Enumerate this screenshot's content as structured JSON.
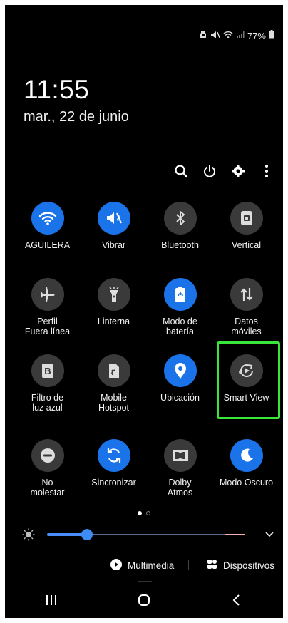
{
  "status_bar": {
    "battery_percent": "77%",
    "icons": [
      "alarm-icon",
      "mute-icon",
      "wifi-icon",
      "signal-icon",
      "battery-icon"
    ]
  },
  "clock": {
    "time": "11:55",
    "date": "mar., 22 de junio"
  },
  "top_actions": [
    "search-icon",
    "power-icon",
    "gear-icon",
    "more-vertical-icon"
  ],
  "tiles": [
    {
      "id": "wifi",
      "label": "AGUILERA",
      "state": "on",
      "icon": "wifi-icon"
    },
    {
      "id": "vibrate",
      "label": "Vibrar",
      "state": "on",
      "icon": "vibrate-icon"
    },
    {
      "id": "bluetooth",
      "label": "Bluetooth",
      "state": "off",
      "icon": "bluetooth-icon"
    },
    {
      "id": "rotation",
      "label": "Vertical",
      "state": "off",
      "icon": "portrait-lock-icon"
    },
    {
      "id": "airplane",
      "label": "Perfil\nFuera línea",
      "state": "off",
      "icon": "airplane-icon"
    },
    {
      "id": "flashlight",
      "label": "Linterna",
      "state": "off",
      "icon": "flashlight-icon"
    },
    {
      "id": "battery-mode",
      "label": "Modo de\nbatería",
      "state": "on",
      "icon": "battery-saver-icon"
    },
    {
      "id": "mobile-data",
      "label": "Datos\nmóviles",
      "state": "off",
      "icon": "data-arrows-icon"
    },
    {
      "id": "blue-light",
      "label": "Filtro de\nluz azul",
      "state": "off",
      "icon": "blue-light-icon"
    },
    {
      "id": "hotspot",
      "label": "Mobile\nHotspot",
      "state": "off",
      "icon": "hotspot-icon"
    },
    {
      "id": "location",
      "label": "Ubicación",
      "state": "on",
      "icon": "location-pin-icon"
    },
    {
      "id": "smart-view",
      "label": "Smart View",
      "state": "off",
      "icon": "smart-view-icon"
    },
    {
      "id": "dnd",
      "label": "No\nmolestar",
      "state": "off",
      "icon": "do-not-disturb-icon"
    },
    {
      "id": "sync",
      "label": "Sincronizar",
      "state": "on",
      "icon": "sync-icon"
    },
    {
      "id": "dolby",
      "label": "Dolby\nAtmos",
      "state": "off",
      "icon": "dolby-icon"
    },
    {
      "id": "dark-mode",
      "label": "Modo Oscuro",
      "state": "on",
      "icon": "moon-icon"
    }
  ],
  "pager": {
    "pages": 2,
    "current": 1
  },
  "brightness": {
    "level": 0.2
  },
  "bottom_buttons": {
    "media_label": "Multimedia",
    "devices_label": "Dispositivos"
  },
  "nav": [
    "recents-icon",
    "home-icon",
    "back-icon"
  ],
  "colors": {
    "accent": "#1a73e8",
    "tile_off": "#3a3a3a",
    "highlight": "#39e639",
    "background": "#000000"
  }
}
